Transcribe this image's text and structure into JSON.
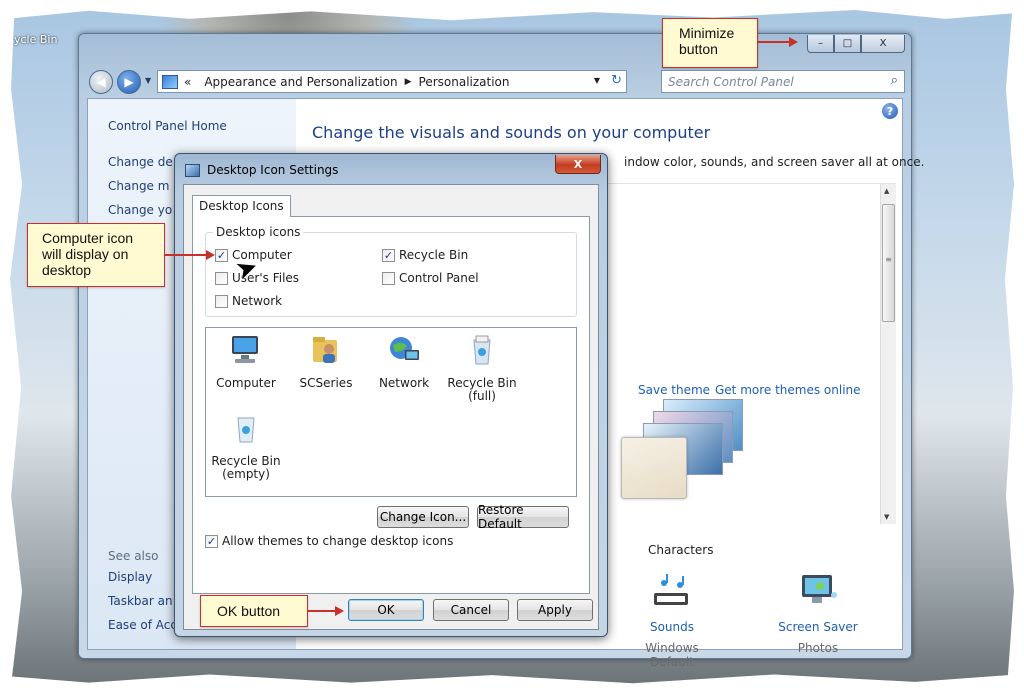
{
  "desktop": {
    "label": "ycle Bin"
  },
  "window": {
    "controls": {
      "minimize": "–",
      "maximize": "□",
      "close": "X"
    },
    "address": {
      "parts": [
        "Appearance and Personalization",
        "Personalization"
      ],
      "prefix": "«",
      "separator": "▶",
      "dropdown": "▼",
      "refresh": "↻"
    },
    "search": {
      "placeholder": "Search Control Panel",
      "icon": "⌕"
    },
    "help_icon": "?",
    "left_pane": {
      "home": "Control Panel Home",
      "links": [
        "Change de",
        "Change m",
        "Change yo"
      ],
      "see_also": "See also",
      "see_also_links": [
        "Display",
        "Taskbar an",
        "Ease of Acc"
      ]
    },
    "title": "Change the visuals and sounds on your computer",
    "subtitle": "indow color, sounds, and screen saver all at once.",
    "save_theme": "Save theme",
    "more_themes": "Get more themes online",
    "selected_theme": "Characters",
    "sounds": {
      "title": "Sounds",
      "sub": "Windows Default"
    },
    "screen_saver": {
      "title": "Screen Saver",
      "sub": "Photos"
    }
  },
  "dialog": {
    "title": "Desktop Icon Settings",
    "close": "X",
    "tab": "Desktop Icons",
    "group_label": "Desktop icons",
    "checkboxes": [
      {
        "label": "Computer",
        "checked": true
      },
      {
        "label": "User's Files",
        "checked": false
      },
      {
        "label": "Network",
        "checked": false
      },
      {
        "label": "Recycle Bin",
        "checked": true
      },
      {
        "label": "Control Panel",
        "checked": false
      }
    ],
    "icons": [
      {
        "label": "Computer"
      },
      {
        "label": "SCSeries"
      },
      {
        "label": "Network"
      },
      {
        "label": "Recycle Bin (full)"
      },
      {
        "label": "Recycle Bin (empty)"
      }
    ],
    "change_icon": "Change Icon...",
    "restore_default": "Restore Default",
    "allow_themes": {
      "label": "Allow themes to change desktop icons",
      "checked": true
    },
    "ok": "OK",
    "cancel": "Cancel",
    "apply": "Apply"
  },
  "callouts": {
    "minimize": "Minimize button",
    "computer": "Computer icon will display on desktop",
    "ok": "OK button"
  },
  "colors": {
    "callout_bg": "#fffad1",
    "callout_border": "#c9302c",
    "link": "#1e5fb4",
    "title": "#1c3f8a"
  }
}
